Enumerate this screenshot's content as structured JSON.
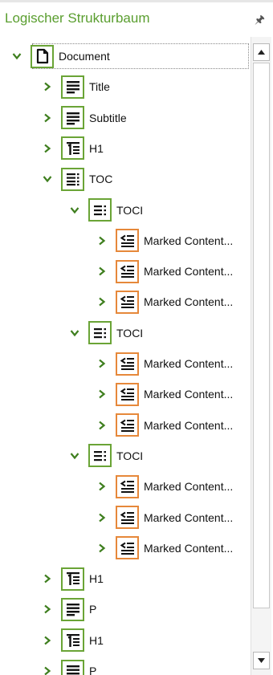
{
  "panel": {
    "title": "Logischer Strukturbaum",
    "pin_icon": "pin-icon"
  },
  "colors": {
    "accent_green": "#6aa436",
    "title_green": "#5a9e2f",
    "marked_orange": "#e6883a"
  },
  "tree": [
    {
      "label": "Document",
      "icon": "document-icon",
      "expanded": true,
      "depth": 0,
      "color": "green"
    },
    {
      "label": "Title",
      "icon": "paragraph-icon",
      "expanded": false,
      "depth": 1,
      "color": "green"
    },
    {
      "label": "Subtitle",
      "icon": "paragraph-icon",
      "expanded": false,
      "depth": 1,
      "color": "green"
    },
    {
      "label": "H1",
      "icon": "heading-icon",
      "expanded": false,
      "depth": 1,
      "color": "green"
    },
    {
      "label": "TOC",
      "icon": "toc-icon",
      "expanded": true,
      "depth": 1,
      "color": "green"
    },
    {
      "label": "TOCI",
      "icon": "toci-icon",
      "expanded": true,
      "depth": 2,
      "color": "green"
    },
    {
      "label": "Marked Content...",
      "icon": "marked-content-icon",
      "expanded": false,
      "depth": 3,
      "color": "orange"
    },
    {
      "label": "Marked Content...",
      "icon": "marked-content-icon",
      "expanded": false,
      "depth": 3,
      "color": "orange"
    },
    {
      "label": "Marked Content...",
      "icon": "marked-content-icon",
      "expanded": false,
      "depth": 3,
      "color": "orange"
    },
    {
      "label": "TOCI",
      "icon": "toci-icon",
      "expanded": true,
      "depth": 2,
      "color": "green"
    },
    {
      "label": "Marked Content...",
      "icon": "marked-content-icon",
      "expanded": false,
      "depth": 3,
      "color": "orange"
    },
    {
      "label": "Marked Content...",
      "icon": "marked-content-icon",
      "expanded": false,
      "depth": 3,
      "color": "orange"
    },
    {
      "label": "Marked Content...",
      "icon": "marked-content-icon",
      "expanded": false,
      "depth": 3,
      "color": "orange"
    },
    {
      "label": "TOCI",
      "icon": "toci-icon",
      "expanded": true,
      "depth": 2,
      "color": "green"
    },
    {
      "label": "Marked Content...",
      "icon": "marked-content-icon",
      "expanded": false,
      "depth": 3,
      "color": "orange"
    },
    {
      "label": "Marked Content...",
      "icon": "marked-content-icon",
      "expanded": false,
      "depth": 3,
      "color": "orange"
    },
    {
      "label": "Marked Content...",
      "icon": "marked-content-icon",
      "expanded": false,
      "depth": 3,
      "color": "orange"
    },
    {
      "label": "H1",
      "icon": "heading-icon",
      "expanded": false,
      "depth": 1,
      "color": "green"
    },
    {
      "label": "P",
      "icon": "paragraph-icon",
      "expanded": false,
      "depth": 1,
      "color": "green"
    },
    {
      "label": "H1",
      "icon": "heading-icon",
      "expanded": false,
      "depth": 1,
      "color": "green"
    },
    {
      "label": "P",
      "icon": "paragraph-icon",
      "expanded": false,
      "depth": 1,
      "color": "green"
    }
  ]
}
